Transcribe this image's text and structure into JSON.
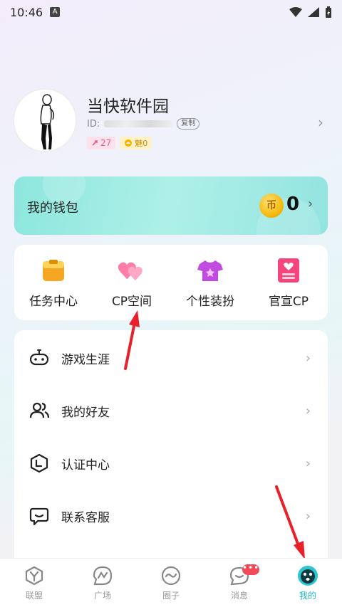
{
  "status_bar": {
    "time": "10:46",
    "badge": "A"
  },
  "profile": {
    "username": "当快软件园",
    "id_label": "ID:",
    "copy_label": "复制",
    "badge_level": "27",
    "badge_charm": "魅0"
  },
  "wallet": {
    "label": "我的钱包",
    "coin_glyph": "币",
    "amount": "0"
  },
  "features": [
    {
      "label": "任务中心",
      "icon": "task-icon"
    },
    {
      "label": "CP空间",
      "icon": "hearts-icon"
    },
    {
      "label": "个性装扮",
      "icon": "outfit-icon"
    },
    {
      "label": "官宣CP",
      "icon": "announce-icon"
    }
  ],
  "menu": [
    {
      "label": "游戏生涯",
      "icon": "gamepad-icon"
    },
    {
      "label": "我的好友",
      "icon": "friends-icon"
    },
    {
      "label": "认证中心",
      "icon": "certify-icon"
    },
    {
      "label": "联系客服",
      "icon": "support-icon"
    }
  ],
  "tabs": [
    {
      "label": "联盟",
      "icon": "alliance-icon"
    },
    {
      "label": "广场",
      "icon": "plaza-icon"
    },
    {
      "label": "圈子",
      "icon": "circle-icon"
    },
    {
      "label": "消息",
      "icon": "message-icon",
      "dot": "•••"
    },
    {
      "label": "我的",
      "icon": "mine-icon",
      "active": true
    }
  ],
  "colors": {
    "accent": "#20b6c8",
    "wallet": "#8ce6dd",
    "arrow": "#e8202a"
  }
}
